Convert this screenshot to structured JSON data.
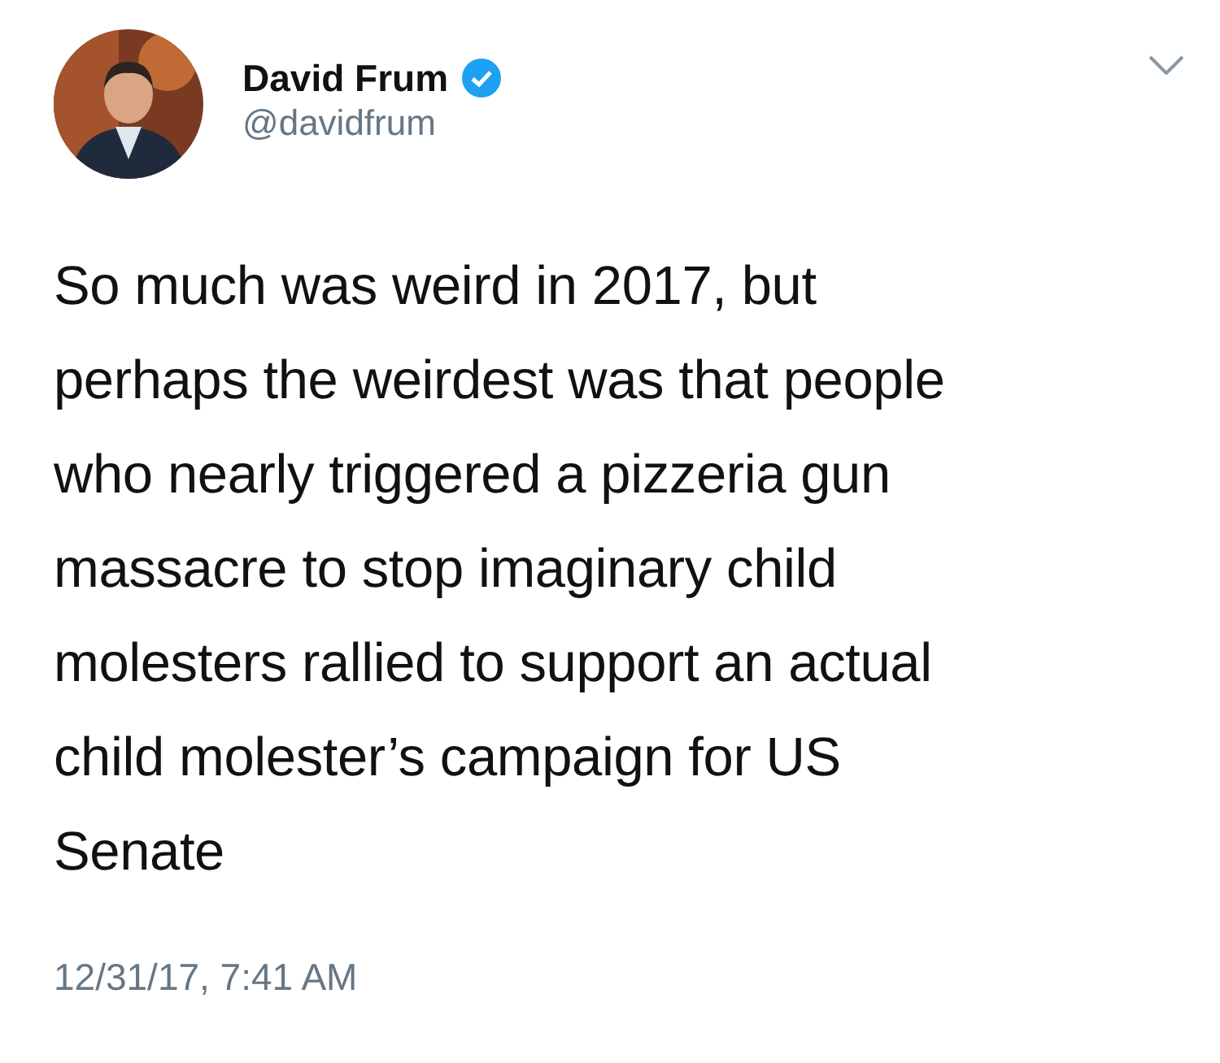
{
  "author": {
    "name": "David Frum",
    "verified": true,
    "handle": "@davidfrum"
  },
  "tweet": {
    "lines": [
      "So much was weird in 2017, but",
      "perhaps the weirdest was that people",
      "who nearly triggered a pizzeria gun",
      "massacre to stop imaginary child",
      "molesters rallied to support an actual",
      "child molester’s campaign for US",
      "Senate"
    ]
  },
  "timestamp": "12/31/17, 7:41 AM"
}
